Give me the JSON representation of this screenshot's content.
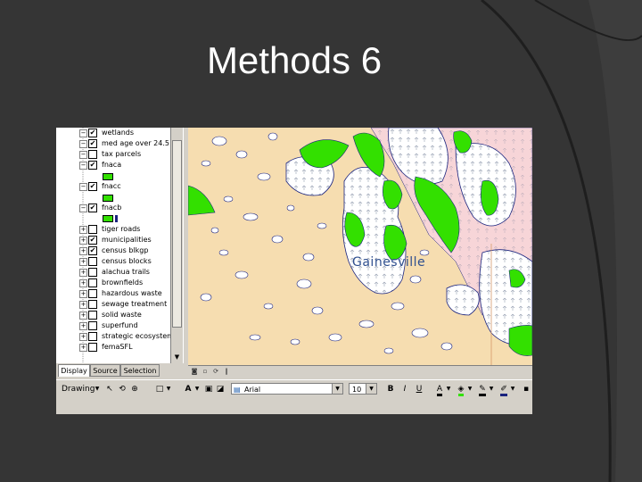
{
  "slide": {
    "title": "Methods 6"
  },
  "toc": {
    "layers": [
      {
        "name": "wetlands",
        "checked": true,
        "expand": "minus"
      },
      {
        "name": "med age over 24.5",
        "checked": true,
        "expand": "minus"
      },
      {
        "name": "tax parcels",
        "checked": false,
        "expand": "minus"
      },
      {
        "name": "fnaca",
        "checked": true,
        "expand": "minus"
      },
      {
        "name": "fnacc",
        "checked": true,
        "expand": "minus"
      },
      {
        "name": "fnacb",
        "checked": true,
        "expand": "minus"
      },
      {
        "name": "tiger roads",
        "checked": false,
        "expand": "plus"
      },
      {
        "name": "municipalities",
        "checked": true,
        "expand": "plus"
      },
      {
        "name": "census blkgp",
        "checked": true,
        "expand": "plus"
      },
      {
        "name": "census blocks",
        "checked": false,
        "expand": "plus"
      },
      {
        "name": "alachua trails",
        "checked": false,
        "expand": "plus"
      },
      {
        "name": "brownfields",
        "checked": false,
        "expand": "plus"
      },
      {
        "name": "hazardous waste",
        "checked": false,
        "expand": "plus"
      },
      {
        "name": "sewage treatment",
        "checked": false,
        "expand": "plus"
      },
      {
        "name": "solid waste",
        "checked": false,
        "expand": "plus"
      },
      {
        "name": "superfund",
        "checked": false,
        "expand": "plus"
      },
      {
        "name": "strategic ecosystems",
        "checked": false,
        "expand": "plus"
      },
      {
        "name": "femaSFL",
        "checked": false,
        "expand": "plus"
      }
    ],
    "tabs": [
      "Display",
      "Source",
      "Selection"
    ],
    "active_tab": "Display"
  },
  "map": {
    "label": "Gainesville",
    "colors": {
      "base": "#f6ddb0",
      "green": "#33e000",
      "pink": "#f7d5d8",
      "urban_outline": "#1a237e"
    }
  },
  "drawing_toolbar": {
    "drawing_label": "Drawing",
    "font_name": "Arial",
    "font_size": "10",
    "bold": "B",
    "italic": "I",
    "underline": "U",
    "text_tool": "A"
  },
  "icons": {
    "scroll_down": "▼",
    "dropdown": "▼",
    "pointer": "↖",
    "rotate": "⟲",
    "zoom": "⊕",
    "rectangle": "□"
  }
}
